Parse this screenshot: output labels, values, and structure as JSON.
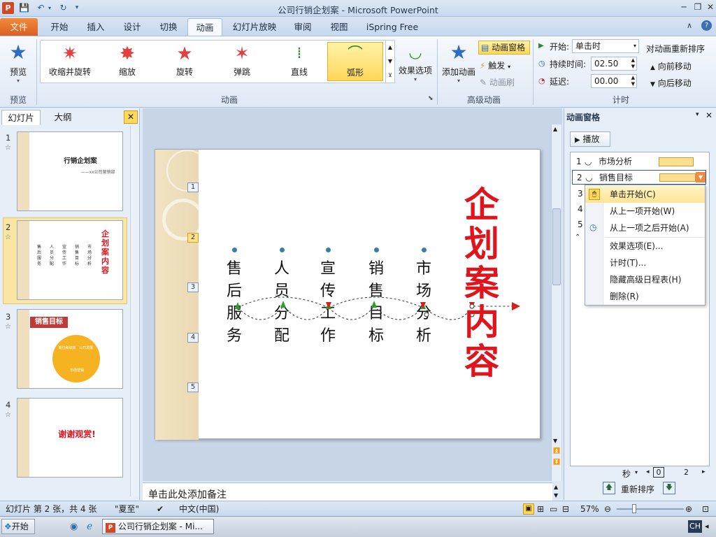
{
  "window": {
    "title": "公司行销企划案 - Microsoft PowerPoint"
  },
  "tabs": [
    {
      "label": "文件"
    },
    {
      "label": "开始"
    },
    {
      "label": "插入"
    },
    {
      "label": "设计"
    },
    {
      "label": "切换"
    },
    {
      "label": "动画"
    },
    {
      "label": "幻灯片放映"
    },
    {
      "label": "审阅"
    },
    {
      "label": "视图"
    },
    {
      "label": "iSpring Free"
    }
  ],
  "ribbon": {
    "preview": {
      "label": "预览",
      "group": "预览"
    },
    "animations": [
      {
        "label": "收缩并旋转"
      },
      {
        "label": "缩放"
      },
      {
        "label": "旋转"
      },
      {
        "label": "弹跳"
      },
      {
        "label": "直线"
      },
      {
        "label": "弧形"
      }
    ],
    "anim_group": "动画",
    "effect_options": "效果选项",
    "add_animation": "添加动画",
    "anim_pane": "动画窗格",
    "trigger": "触发",
    "anim_painter": "动画刷",
    "adv_group": "高级动画",
    "start_label": "开始:",
    "start_value": "单击时",
    "duration_label": "持续时间:",
    "duration_value": "02.50",
    "delay_label": "延迟:",
    "delay_value": "00.00",
    "reorder_title": "对动画重新排序",
    "move_earlier": "向前移动",
    "move_later": "向后移动",
    "timing_group": "计时"
  },
  "left_pane": {
    "tab_slides": "幻灯片",
    "tab_outline": "大纲",
    "thumbs": [
      {
        "num": "1",
        "title": "行销企划案",
        "sub": "——xx公司营销部"
      },
      {
        "num": "2"
      },
      {
        "num": "3",
        "title": "销售目标",
        "c1": "岗位和绩效",
        "c2": "公司发展",
        "c3": "市场营销"
      },
      {
        "num": "4",
        "title": "谢谢观赏!"
      }
    ]
  },
  "slide": {
    "title": "企划案内容",
    "markers": [
      "1",
      "2",
      "3",
      "4",
      "5"
    ],
    "columns": [
      {
        "text": "售后服务"
      },
      {
        "text": "人员分配"
      },
      {
        "text": "宣传工作"
      },
      {
        "text": "销售目标"
      },
      {
        "text": "市场分析"
      }
    ]
  },
  "notes": {
    "placeholder": "单击此处添加备注"
  },
  "anim_pane": {
    "title": "动画窗格",
    "play": "播放",
    "items": [
      {
        "num": "1",
        "label": "市场分析"
      },
      {
        "num": "2",
        "label": "销售目标"
      },
      {
        "num": "3"
      },
      {
        "num": "4"
      },
      {
        "num": "5"
      }
    ],
    "timeline_unit": "秒",
    "timeline_0": "0",
    "timeline_2": "2",
    "reorder": "重新排序"
  },
  "context_menu": [
    "单击开始(C)",
    "从上一项开始(W)",
    "从上一项之后开始(A)",
    "效果选项(E)...",
    "计时(T)...",
    "隐藏高级日程表(H)",
    "删除(R)"
  ],
  "status": {
    "slide_info": "幻灯片 第 2 张，共 4 张",
    "theme": "\"夏至\"",
    "lang": "中文(中国)",
    "zoom": "57%"
  },
  "taskbar": {
    "start": "开始",
    "task": "公司行销企划案 - Mi...",
    "ime": "CH"
  }
}
